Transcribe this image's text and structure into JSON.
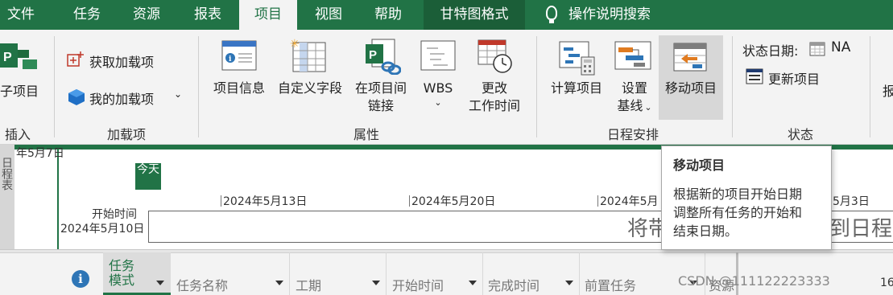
{
  "tabs": [
    "文件",
    "任务",
    "资源",
    "报表",
    "项目",
    "视图",
    "帮助",
    "甘特图格式",
    "操作说明搜索"
  ],
  "ribbon": {
    "subproject_label": "子项目",
    "insert_group": "插入",
    "get_addins": "获取加载项",
    "my_addins": "我的加载项",
    "addins_group": "加载项",
    "project_info": "项目信息",
    "custom_fields": "自定义字段",
    "links_line1": "在项目间",
    "links_line2": "链接",
    "wbs": "WBS",
    "change_time_line1": "更改",
    "change_time_line2": "工作时间",
    "properties_group": "属性",
    "calc_project": "计算项目",
    "set_baseline_line1": "设置",
    "set_baseline_line2": "基线",
    "move_project": "移动项目",
    "schedule_group": "日程安排",
    "status_date_label": "状态日期:",
    "status_date_value": "NA",
    "update_project": "更新项目",
    "status_group": "状态",
    "cut_char": "报"
  },
  "timeline": {
    "side_label": "日程表",
    "top_left_date": "年5月7日",
    "today": "今天",
    "start_label": "开始时间",
    "start_date": "2024年5月10日",
    "ticks": [
      "2024年5月13日",
      "2024年5月20日",
      "2024年5月",
      "5月3日"
    ],
    "bar_text_left": "将带",
    "bar_text_right": "到日程"
  },
  "grid": {
    "columns": [
      "任务",
      "模式",
      "任务名称",
      "工期",
      "开始时间",
      "完成时间",
      "前置任务",
      "资源"
    ]
  },
  "tooltip": {
    "title": "移动项目",
    "body_lines": [
      "根据新的项目开始日期",
      "调整所有任务的开始和",
      "结束日期。"
    ]
  },
  "watermark": "CSDN @111122223333",
  "trailing_digit": "16"
}
